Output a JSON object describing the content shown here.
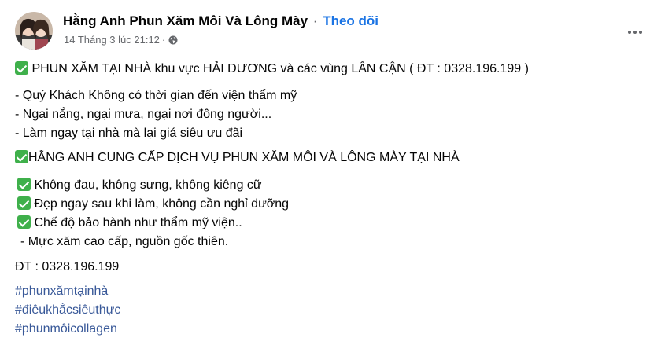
{
  "header": {
    "page_name": "Hằng Anh Phun Xăm Môi Và Lông Mày",
    "separator": "·",
    "follow_label": "Theo dõi",
    "timestamp": "14 Tháng 3 lúc 21:12",
    "meta_separator": "·",
    "privacy_icon": "globe-icon",
    "more_icon": "more-options-icon"
  },
  "post": {
    "headline": " PHUN XĂM TẠI NHÀ khu vực HẢI DƯƠNG và các vùng LÂN CẬN ( ĐT : 0328.196.199 )",
    "reasons": [
      "- Quý Khách Không có thời gian đến viện thẩm mỹ",
      "- Ngại nắng, ngại mưa, ngại nơi đông người...",
      "- Làm ngay tại nhà mà lại giá siêu ưu đãi"
    ],
    "service_heading": "HẰNG ANH CUNG CẤP DỊCH VỤ PHUN XĂM MÔI VÀ LÔNG MÀY TẠI NHÀ",
    "benefits": [
      " Không đau, không sưng, không kiêng cữ",
      " Đẹp ngay sau khi làm, không cần nghỉ dưỡng",
      " Chế độ bảo hành như thẩm mỹ viện.."
    ],
    "ink_note": "- Mực xăm cao cấp, nguồn gốc thiên.",
    "phone": "ĐT : 0328.196.199",
    "hashtags": [
      "#phunxămtạinhà",
      "#điêukhắcsiêuthực",
      "#phunmôicollagen"
    ]
  },
  "colors": {
    "link_blue": "#1b74e4",
    "hashtag_blue": "#385898",
    "check_green": "#3fb04b",
    "secondary_text": "#65676b"
  }
}
